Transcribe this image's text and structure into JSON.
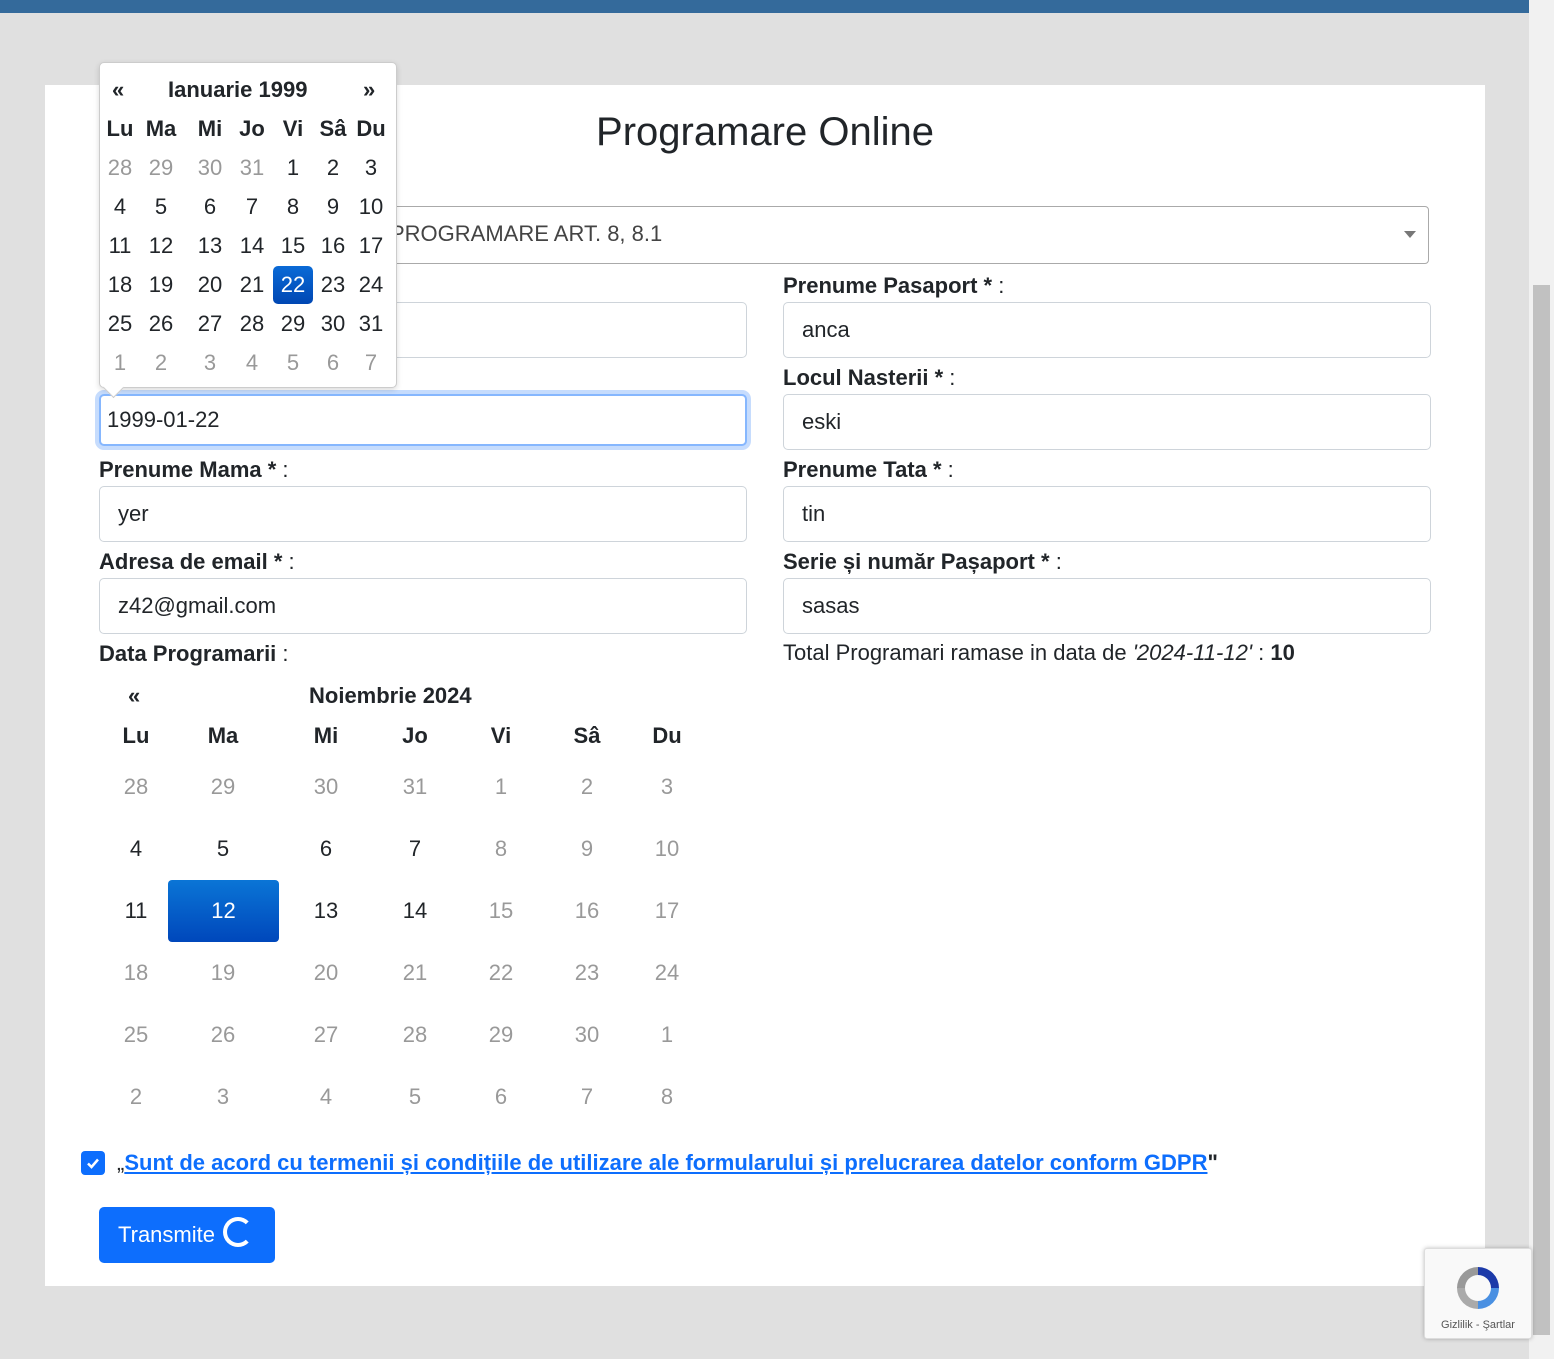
{
  "page_title": "Programare Online",
  "select": {
    "value": "PROGRAMARE ART. 8, 8.1"
  },
  "fields": {
    "prenume_pasaport": {
      "label": "Prenume Pasaport",
      "req": " * ",
      "colon": ":",
      "value": "anca"
    },
    "locul_nasterii": {
      "label": "Locul Nasterii",
      "req": " * ",
      "colon": ":",
      "value": "eski"
    },
    "data_nasterii": {
      "value": "1999-01-22"
    },
    "prenume_mama": {
      "label": "Prenume Mama",
      "req": " * ",
      "colon": ":",
      "value": "yer"
    },
    "prenume_tata": {
      "label": "Prenume Tata",
      "req": " * ",
      "colon": ":",
      "value": "tin"
    },
    "email": {
      "label": "Adresa de email",
      "req": " * ",
      "colon": ":",
      "value": "z42@gmail.com"
    },
    "pasaport": {
      "label": "Serie și număr Pașaport",
      "req": " * ",
      "colon": ":",
      "value": "sasas"
    },
    "data_programarii": {
      "label": "Data Programarii",
      "colon": " :"
    }
  },
  "info": {
    "prefix": "Total Programari ramase in data de ",
    "date": "'2024-11-12'",
    "mid": " : ",
    "count": "10"
  },
  "popup_calendar": {
    "prev": "«",
    "next": "»",
    "month": "Ianuarie 1999",
    "dow": [
      "Lu",
      "Ma",
      "Mi",
      "Jo",
      "Vi",
      "Sâ",
      "Du"
    ],
    "weeks": [
      [
        "28",
        "29",
        "30",
        "31",
        "1",
        "2",
        "3"
      ],
      [
        "4",
        "5",
        "6",
        "7",
        "8",
        "9",
        "10"
      ],
      [
        "11",
        "12",
        "13",
        "14",
        "15",
        "16",
        "17"
      ],
      [
        "18",
        "19",
        "20",
        "21",
        "22",
        "23",
        "24"
      ],
      [
        "25",
        "26",
        "27",
        "28",
        "29",
        "30",
        "31"
      ],
      [
        "1",
        "2",
        "3",
        "4",
        "5",
        "6",
        "7"
      ]
    ],
    "selected": "22"
  },
  "inline_calendar": {
    "prev": "«",
    "month": "Noiembrie 2024",
    "dow": [
      "Lu",
      "Ma",
      "Mi",
      "Jo",
      "Vi",
      "Sâ",
      "Du"
    ],
    "weeks": [
      [
        "28",
        "29",
        "30",
        "31",
        "1",
        "2",
        "3"
      ],
      [
        "4",
        "5",
        "6",
        "7",
        "8",
        "9",
        "10"
      ],
      [
        "11",
        "12",
        "13",
        "14",
        "15",
        "16",
        "17"
      ],
      [
        "18",
        "19",
        "20",
        "21",
        "22",
        "23",
        "24"
      ],
      [
        "25",
        "26",
        "27",
        "28",
        "29",
        "30",
        "1"
      ],
      [
        "2",
        "3",
        "4",
        "5",
        "6",
        "7",
        "8"
      ]
    ],
    "selected": "12"
  },
  "agreement": {
    "open_quote": "„",
    "link": "Sunt de acord cu termenii și condițiile de utilizare ale formularului și prelucrarea datelor conform GDPR",
    "close_quote": "\""
  },
  "submit": {
    "label": "Transmite"
  },
  "recaptcha": {
    "text": "Gizlilik - Şartlar"
  }
}
